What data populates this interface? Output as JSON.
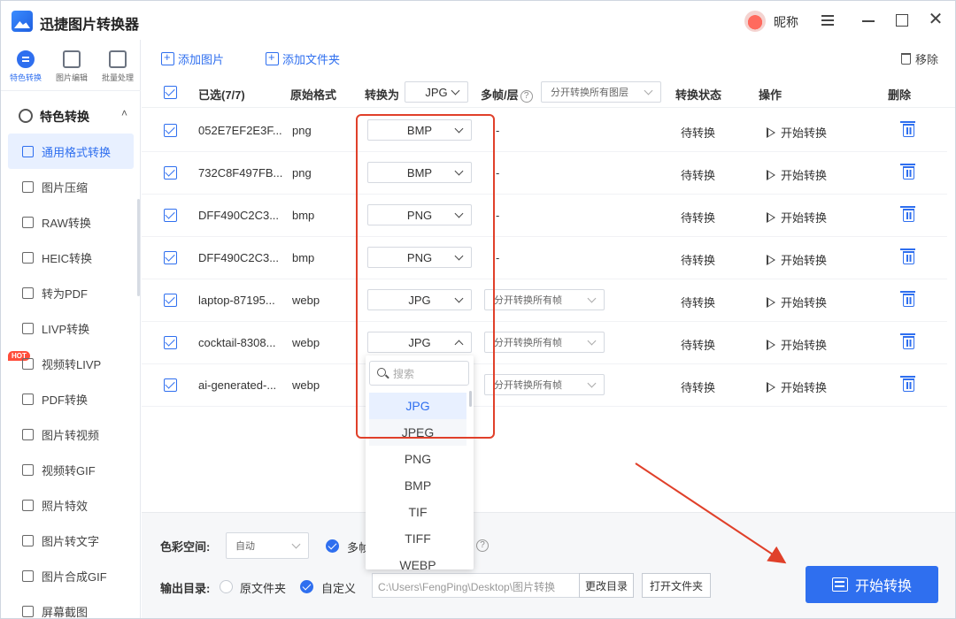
{
  "app": {
    "title": "迅捷图片转换器",
    "nickname": "昵称"
  },
  "topnav": [
    {
      "label": "特色转换",
      "active": true
    },
    {
      "label": "图片编辑",
      "active": false
    },
    {
      "label": "批量处理",
      "active": false
    }
  ],
  "sidebar": {
    "section_title": "特色转换",
    "items": [
      {
        "label": "通用格式转换",
        "active": true
      },
      {
        "label": "图片压缩"
      },
      {
        "label": "RAW转换"
      },
      {
        "label": "HEIC转换"
      },
      {
        "label": "转为PDF"
      },
      {
        "label": "LIVP转换"
      },
      {
        "label": "视频转LIVP",
        "badge": "HOT"
      },
      {
        "label": "PDF转换"
      },
      {
        "label": "图片转视频"
      },
      {
        "label": "视频转GIF"
      },
      {
        "label": "照片特效"
      },
      {
        "label": "图片转文字"
      },
      {
        "label": "图片合成GIF"
      },
      {
        "label": "屏幕截图"
      }
    ]
  },
  "toolbar": {
    "add_image": "添加图片",
    "add_folder": "添加文件夹",
    "remove": "移除"
  },
  "table": {
    "headers": {
      "selected": "已选(7/7)",
      "orig_format": "原始格式",
      "convert_to": "转换为",
      "convert_to_value": "JPG",
      "multi_frame": "多帧/层",
      "help": "?",
      "multi_frame_select": "分开转换所有图层",
      "status": "转换状态",
      "action": "操作",
      "delete": "删除"
    },
    "rows": [
      {
        "name": "052E7EF2E3F...",
        "format": "png",
        "target": "BMP",
        "frames": "-",
        "status": "待转换",
        "action": "开始转换"
      },
      {
        "name": "732C8F497FB...",
        "format": "png",
        "target": "BMP",
        "frames": "-",
        "status": "待转换",
        "action": "开始转换"
      },
      {
        "name": "DFF490C2C3...",
        "format": "bmp",
        "target": "PNG",
        "frames": "-",
        "status": "待转换",
        "action": "开始转换"
      },
      {
        "name": "DFF490C2C3...",
        "format": "bmp",
        "target": "PNG",
        "frames": "-",
        "status": "待转换",
        "action": "开始转换"
      },
      {
        "name": "laptop-87195...",
        "format": "webp",
        "target": "JPG",
        "frames": "分开转换所有帧",
        "status": "待转换",
        "action": "开始转换"
      },
      {
        "name": "cocktail-8308...",
        "format": "webp",
        "target": "JPG",
        "frames": "分开转换所有帧",
        "status": "待转换",
        "action": "开始转换"
      },
      {
        "name": "ai-generated-...",
        "format": "webp",
        "target": "",
        "frames": "分开转换所有帧",
        "status": "待转换",
        "action": "开始转换"
      }
    ]
  },
  "dropdown": {
    "search_placeholder": "搜索",
    "options": [
      "JPG",
      "JPEG",
      "PNG",
      "BMP",
      "TIF",
      "TIFF",
      "WEBP"
    ],
    "selected": "JPG"
  },
  "footer": {
    "color_space_label": "色彩空间:",
    "color_space_value": "自动",
    "multi_label": "多帧",
    "help": "?",
    "output_label": "输出目录:",
    "opt_original": "原文件夹",
    "opt_custom": "自定义",
    "path": "C:\\Users\\FengPing\\Desktop\\图片转换",
    "change_dir": "更改目录",
    "open_folder": "打开文件夹",
    "start": "开始转换"
  },
  "colors": {
    "accent": "#2f6fef",
    "highlight": "#e0402a"
  }
}
